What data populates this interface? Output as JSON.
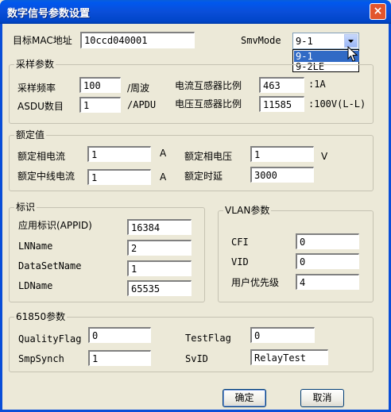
{
  "window": {
    "title": "数字信号参数设置",
    "close_glyph": "×"
  },
  "top": {
    "mac_label": "目标MAC地址",
    "mac_value": "10ccd040001",
    "smv_label": "SmvMode",
    "smv_selected": "9-1",
    "smv_options": [
      "9-1",
      "9-2LE"
    ]
  },
  "sampling": {
    "title": "采样参数",
    "freq_label": "采样频率",
    "freq_value": "100",
    "freq_unit": "/周波",
    "asdu_label": "ASDU数目",
    "asdu_value": "1",
    "asdu_unit": "/APDU",
    "ct_label": "电流互感器比例",
    "ct_value": "463",
    "ct_unit": ":1A",
    "vt_label": "电压互感器比例",
    "vt_value": "11585",
    "vt_unit": ":100V(L-L)"
  },
  "rated": {
    "title": "额定值",
    "phase_current_label": "额定相电流",
    "phase_current_value": "1",
    "phase_current_unit": "A",
    "phase_voltage_label": "额定相电压",
    "phase_voltage_value": "1",
    "phase_voltage_unit": "V",
    "neutral_current_label": "额定中线电流",
    "neutral_current_value": "1",
    "neutral_current_unit": "A",
    "delay_label": "额定时延",
    "delay_value": "3000"
  },
  "ident": {
    "title": "标识",
    "appid_label": "应用标识(APPID)",
    "appid_value": "16384",
    "lnname_label": "LNName",
    "lnname_value": "2",
    "dataset_label": "DataSetName",
    "dataset_value": "1",
    "ldname_label": "LDName",
    "ldname_value": "65535"
  },
  "vlan": {
    "title": "VLAN参数",
    "cfi_label": "CFI",
    "cfi_value": "0",
    "vid_label": "VID",
    "vid_value": "0",
    "priority_label": "用户优先级",
    "priority_value": "4"
  },
  "iec61850": {
    "title": "61850参数",
    "quality_label": "QualityFlag",
    "quality_value": "0",
    "test_label": "TestFlag",
    "test_value": "0",
    "smpsynch_label": "SmpSynch",
    "smpsynch_value": "1",
    "svid_label": "SvID",
    "svid_value": "RelayTest"
  },
  "buttons": {
    "ok": "确定",
    "cancel": "取消"
  }
}
